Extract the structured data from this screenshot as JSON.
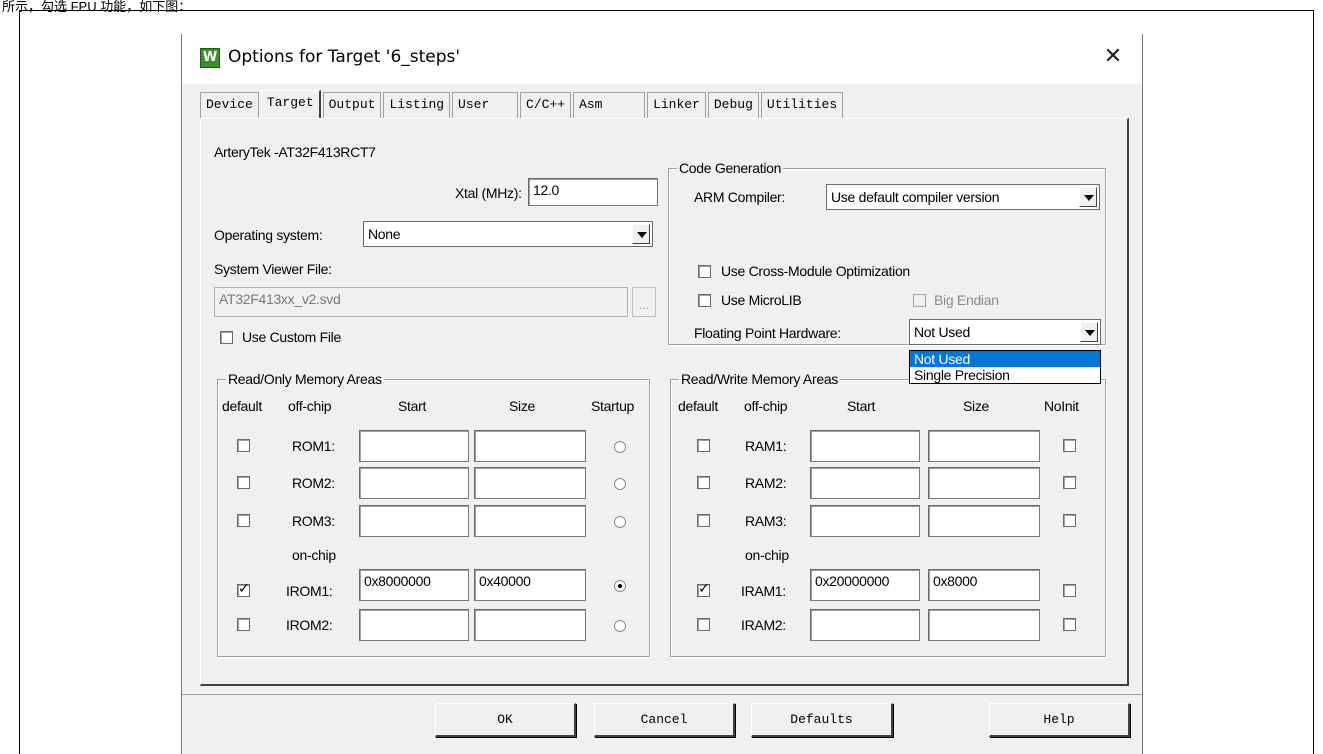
{
  "caption": "所示，勾选 FPU 功能，如下图：",
  "dialog": {
    "title": "Options for Target '6_steps'",
    "app_icon_letter": "W",
    "close_glyph": "✕"
  },
  "tabs": [
    "Device",
    "Target",
    "Output",
    "Listing",
    "User",
    "C/C++",
    "Asm",
    "Linker",
    "Debug",
    "Utilities"
  ],
  "active_tab": "Target",
  "target": {
    "device_name": "ArteryTek -AT32F413RCT7",
    "xtal_label": "Xtal (MHz):",
    "xtal_value": "12.0",
    "os_label": "Operating system:",
    "os_value": "None",
    "svf_label": "System Viewer File:",
    "svf_value": "AT32F413xx_v2.svd",
    "svf_browse": "...",
    "use_custom_file_label": "Use Custom File"
  },
  "code_generation": {
    "title": "Code Generation",
    "arm_compiler_label": "ARM Compiler:",
    "arm_compiler_value": "Use default compiler version",
    "cross_module_label": "Use Cross-Module Optimization",
    "microlib_label": "Use MicroLIB",
    "big_endian_label": "Big Endian",
    "fpu_label": "Floating Point Hardware:",
    "fpu_value": "Not Used",
    "fpu_options": [
      "Not Used",
      "Single Precision"
    ]
  },
  "ro_memory": {
    "title": "Read/Only Memory Areas",
    "headers": {
      "default": "default",
      "offchip": "off-chip",
      "start": "Start",
      "size": "Size",
      "startup": "Startup"
    },
    "onchip_label": "on-chip",
    "rows": [
      {
        "name": "ROM1:",
        "start": "",
        "size": "",
        "default": false,
        "startup": false
      },
      {
        "name": "ROM2:",
        "start": "",
        "size": "",
        "default": false,
        "startup": false
      },
      {
        "name": "ROM3:",
        "start": "",
        "size": "",
        "default": false,
        "startup": false
      },
      {
        "name": "IROM1:",
        "start": "0x8000000",
        "size": "0x40000",
        "default": true,
        "startup": true
      },
      {
        "name": "IROM2:",
        "start": "",
        "size": "",
        "default": false,
        "startup": false
      }
    ]
  },
  "rw_memory": {
    "title": "Read/Write Memory Areas",
    "headers": {
      "default": "default",
      "offchip": "off-chip",
      "start": "Start",
      "size": "Size",
      "noinit": "NoInit"
    },
    "onchip_label": "on-chip",
    "rows": [
      {
        "name": "RAM1:",
        "start": "",
        "size": "",
        "default": false,
        "noinit": false
      },
      {
        "name": "RAM2:",
        "start": "",
        "size": "",
        "default": false,
        "noinit": false
      },
      {
        "name": "RAM3:",
        "start": "",
        "size": "",
        "default": false,
        "noinit": false
      },
      {
        "name": "IRAM1:",
        "start": "0x20000000",
        "size": "0x8000",
        "default": true,
        "noinit": false
      },
      {
        "name": "IRAM2:",
        "start": "",
        "size": "",
        "default": false,
        "noinit": false
      }
    ]
  },
  "buttons": {
    "ok": "OK",
    "cancel": "Cancel",
    "defaults": "Defaults",
    "help": "Help"
  }
}
